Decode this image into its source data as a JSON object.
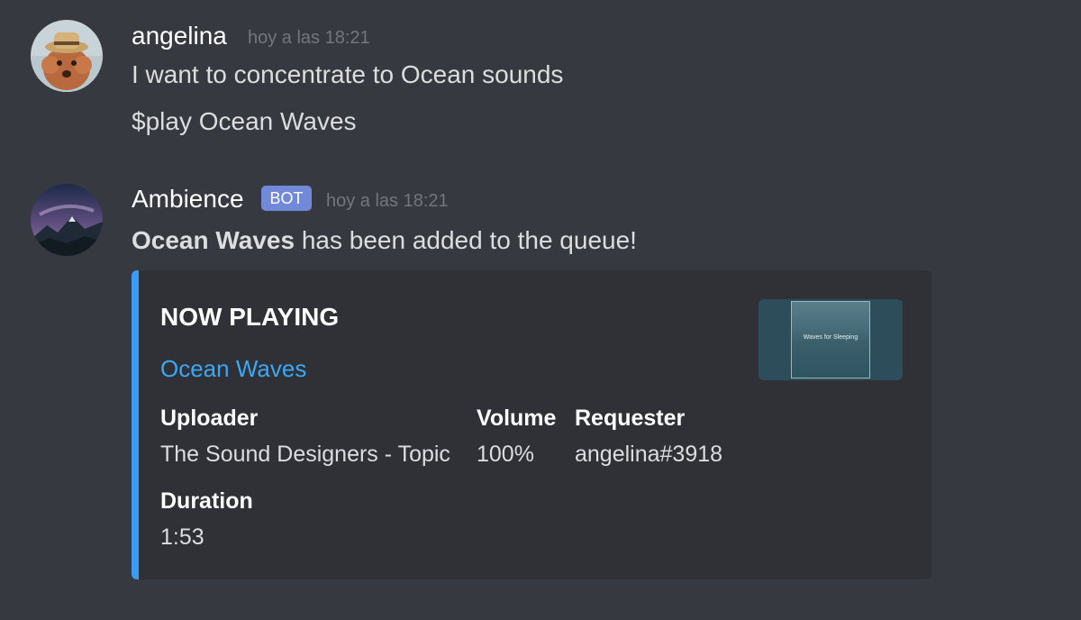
{
  "messages": [
    {
      "username": "angelina",
      "timestamp": "hoy a las 18:21",
      "lines": [
        "I want to concentrate to Ocean sounds",
        "$play Ocean Waves"
      ]
    },
    {
      "username": "Ambience",
      "badge": "BOT",
      "timestamp": "hoy a las 18:21",
      "content_bold": "Ocean Waves",
      "content_rest": " has been added to the queue!",
      "embed": {
        "title": "NOW PLAYING",
        "link_text": "Ocean Waves",
        "thumbnail_text": "Waves for Sleeping",
        "fields": [
          {
            "name": "Uploader",
            "value": "The Sound Designers - Topic"
          },
          {
            "name": "Volume",
            "value": "100%"
          },
          {
            "name": "Requester",
            "value": "angelina#3918"
          },
          {
            "name": "Duration",
            "value": "1:53"
          }
        ]
      }
    }
  ],
  "colors": {
    "background": "#36393f",
    "embed_background": "#2f3136",
    "embed_accent": "#3b9cf5",
    "link": "#3ea6f2",
    "bot_badge": "#7289da",
    "timestamp": "#72767d"
  }
}
